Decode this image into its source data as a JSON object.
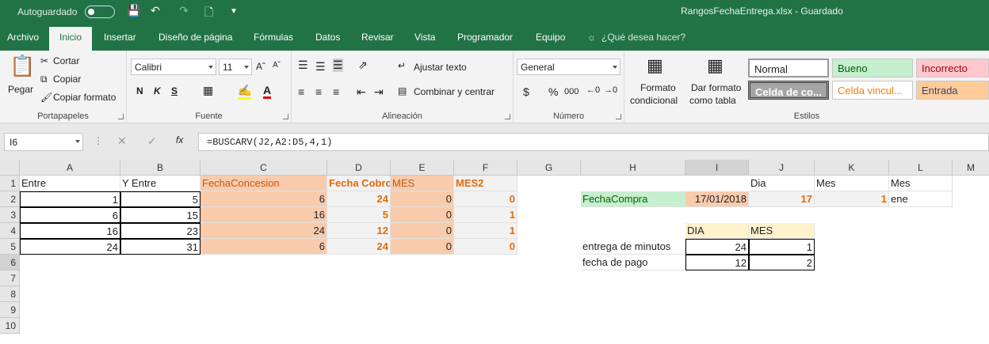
{
  "title_bar": {
    "autosave_label": "Autoguardado",
    "window_title": "RangosFechaEntrega.xlsx  -  Guardado"
  },
  "tabs": [
    "Archivo",
    "Inicio",
    "Insertar",
    "Diseño de página",
    "Fórmulas",
    "Datos",
    "Revisar",
    "Vista",
    "Programador",
    "Equipo"
  ],
  "tell_me": "¿Qué desea hacer?",
  "ribbon": {
    "clipboard": {
      "paste": "Pegar",
      "cut": "Cortar",
      "copy": "Copiar",
      "format_painter": "Copiar formato",
      "label": "Portapapeles"
    },
    "font": {
      "name": "Calibri",
      "size": "11",
      "bold": "N",
      "italic": "K",
      "underline": "S",
      "label": "Fuente"
    },
    "alignment": {
      "wrap": "Ajustar texto",
      "merge": "Combinar y centrar",
      "label": "Alineación"
    },
    "number": {
      "format": "General",
      "currency": "$",
      "percent": "%",
      "thousands": "000",
      "label": "Número"
    },
    "cond_format": {
      "line1": "Formato",
      "line2": "condicional"
    },
    "format_table": {
      "line1": "Dar formato",
      "line2": "como tabla"
    },
    "styles": {
      "normal": "Normal",
      "good": "Bueno",
      "bad": "Incorrecto",
      "check": "Celda de co...",
      "linked": "Celda vincul...",
      "input": "Entrada",
      "label": "Estilos"
    }
  },
  "formula_bar": {
    "cell_ref": "I6",
    "formula": "=BUSCARV(J2,A2:D5,4,1)"
  },
  "columns": [
    "A",
    "B",
    "C",
    "D",
    "E",
    "F",
    "G",
    "H",
    "I",
    "J",
    "K",
    "L",
    "M"
  ],
  "rows": [
    "1",
    "2",
    "3",
    "4",
    "5",
    "6",
    "7",
    "8",
    "9",
    "10"
  ],
  "cells": {
    "A1": "Entre",
    "B1": "Y Entre",
    "C1": "FechaConcesion",
    "D1": "Fecha Cobro",
    "E1": "MES",
    "F1": "MES2",
    "A2": "1",
    "B2": "5",
    "C2": "6",
    "D2": "24",
    "E2": "0",
    "F2": "0",
    "A3": "6",
    "B3": "15",
    "C3": "16",
    "D3": "5",
    "E3": "0",
    "F3": "1",
    "A4": "16",
    "B4": "23",
    "C4": "24",
    "D4": "12",
    "E4": "0",
    "F4": "1",
    "A5": "24",
    "B5": "31",
    "C5": "6",
    "D5": "24",
    "E5": "0",
    "F5": "0",
    "J1": "Dia",
    "K1": "Mes",
    "L1": "Mes",
    "H2": "FechaCompra",
    "I2": "17/01/2018",
    "J2": "17",
    "K2": "1",
    "L2": "ene",
    "I4": "DIA",
    "J4": "MES",
    "H5": "entrega de minutos",
    "I5": "24",
    "J5": "1",
    "H6": "fecha de pago",
    "I6": "12",
    "J6": "2"
  },
  "colors": {
    "brand": "#217346",
    "orange_fill": "#f8cbad",
    "orange_text": "#e26b0a",
    "green_fill": "#c6efce",
    "yellow_fill": "#fff2cc"
  }
}
